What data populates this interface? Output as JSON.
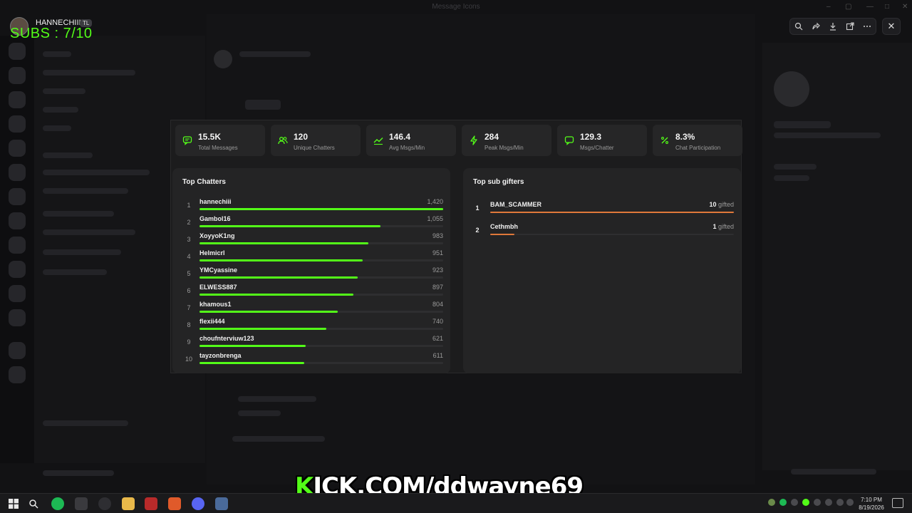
{
  "window": {
    "title": "Message Icons"
  },
  "overlay": {
    "username": "HANNECHIII",
    "badge": "TL",
    "subs_text": "SUBS : 7/10"
  },
  "toolbar": {
    "icons": [
      "zoom-icon",
      "share-icon",
      "download-icon",
      "open-external-icon",
      "more-icon"
    ],
    "close_icon": "close-icon"
  },
  "stats": [
    {
      "icon": "message-icon",
      "value": "15.5K",
      "label": "Total Messages"
    },
    {
      "icon": "users-icon",
      "value": "120",
      "label": "Unique Chatters"
    },
    {
      "icon": "trend-icon",
      "value": "146.4",
      "label": "Avg Msgs/Min"
    },
    {
      "icon": "bolt-icon",
      "value": "284",
      "label": "Peak Msgs/Min"
    },
    {
      "icon": "chat-icon",
      "value": "129.3",
      "label": "Msgs/Chatter"
    },
    {
      "icon": "percent-icon",
      "value": "8.3%",
      "label": "Chat Participation"
    }
  ],
  "top_chatters": {
    "title": "Top Chatters",
    "rows": [
      {
        "rank": "1",
        "name": "hannechiii",
        "count": "1,420",
        "fraction": 1.0
      },
      {
        "rank": "2",
        "name": "Gambol16",
        "count": "1,055",
        "fraction": 0.743
      },
      {
        "rank": "3",
        "name": "XoyyoK1ng",
        "count": "983",
        "fraction": 0.692
      },
      {
        "rank": "4",
        "name": "Helmicrl",
        "count": "951",
        "fraction": 0.67
      },
      {
        "rank": "5",
        "name": "YMCyassine",
        "count": "923",
        "fraction": 0.65
      },
      {
        "rank": "6",
        "name": "ELWESS887",
        "count": "897",
        "fraction": 0.632
      },
      {
        "rank": "7",
        "name": "khamous1",
        "count": "804",
        "fraction": 0.566
      },
      {
        "rank": "8",
        "name": "flexii444",
        "count": "740",
        "fraction": 0.521
      },
      {
        "rank": "9",
        "name": "choufnterviuw123",
        "count": "621",
        "fraction": 0.437
      },
      {
        "rank": "10",
        "name": "tayzonbrenga",
        "count": "611",
        "fraction": 0.43
      }
    ]
  },
  "top_gifters": {
    "title": "Top sub gifters",
    "gifted_word": "gifted",
    "rows": [
      {
        "rank": "1",
        "name": "BAM_SCAMMER",
        "count": "10",
        "fraction": 1.0
      },
      {
        "rank": "2",
        "name": "Cethmbh",
        "count": "1",
        "fraction": 0.1
      }
    ]
  },
  "banner": {
    "k": "K",
    "rest": "ICK.COM/ddwayne69"
  },
  "taskbar": {
    "time": "7:10 PM",
    "date": "8/19/2026"
  },
  "colors": {
    "accent_green": "#53fc18",
    "gifter_orange": "#e0783a"
  }
}
